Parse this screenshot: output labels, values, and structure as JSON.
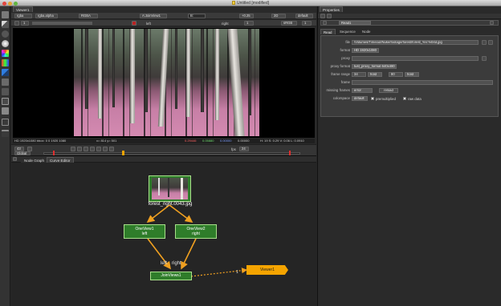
{
  "window": {
    "title": "Untitled [modified]"
  },
  "viewer": {
    "tab": "Viewer1",
    "row1": {
      "layer": "rgba",
      "alpha": "rgba.alpha",
      "display": "RGBA",
      "input_a": "A:JoinView1",
      "input_b": "B:",
      "gain": "+0.25",
      "mode": "2D",
      "lut": "default"
    },
    "row2": {
      "frame": "1",
      "proxy": "1",
      "view_left": "left",
      "view_right": "right",
      "colorspace": "sRGB",
      "zoom": "1"
    },
    "status": {
      "format": "HD 1920x1080 bbox: 0 0 1920 1080",
      "coords": "x= 814 y= 501",
      "r": "0.29446",
      "g": "0.05880",
      "b": "0.00000",
      "a": "0.00000",
      "hsvl": "H: 19 S: 0.29 V: 0.06 L: 0.0910"
    },
    "timeline": {
      "frame": "43",
      "fps_label": "fps",
      "fps": "24",
      "global": "Global"
    }
  },
  "properties": {
    "tab": "Properties",
    "node_name": "Read1",
    "tabs": [
      "Read",
      "Sequence",
      "Node"
    ],
    "fields": {
      "file_label": "file",
      "file_value": "/Volumes/Timeout/Nuke/footage/forest/forest_%V.%04d.jpg",
      "format_label": "format",
      "format_value": "HD 1920x1080",
      "proxy_label": "proxy",
      "proxy_format_label": "proxy format",
      "proxy_format_value": "tust_proxy_format 640x480",
      "frame_range_label": "frame range",
      "frame_start": "34",
      "frame_start_mode": "hold",
      "frame_end": "80",
      "frame_end_mode": "hold",
      "frame_label": "frame",
      "missing_frames_label": "missing frames",
      "missing_frames_value": "error",
      "reload_label": "reload",
      "colorspace_label": "colorspace",
      "colorspace_value": "default",
      "premultiplied_label": "premultiplied",
      "raw_data_label": "raw data"
    }
  },
  "nodegraph": {
    "tabs": [
      "Node Graph",
      "Curve Editor"
    ],
    "read_label": "forest_right.0043.jpg",
    "oneview1": {
      "name": "OneView1",
      "view": "left"
    },
    "oneview2": {
      "name": "OneView2",
      "view": "right"
    },
    "join_label": "JoinViews1",
    "left_label": "left",
    "right_label": "right",
    "viewer_node": "Viewer1",
    "viewer_input": "1"
  },
  "colors": {
    "node_green": "#2f7d2a",
    "viewer_orange": "#f5a400",
    "edge_orange": "#f0a020",
    "forest_pink": "#d48ab1"
  }
}
